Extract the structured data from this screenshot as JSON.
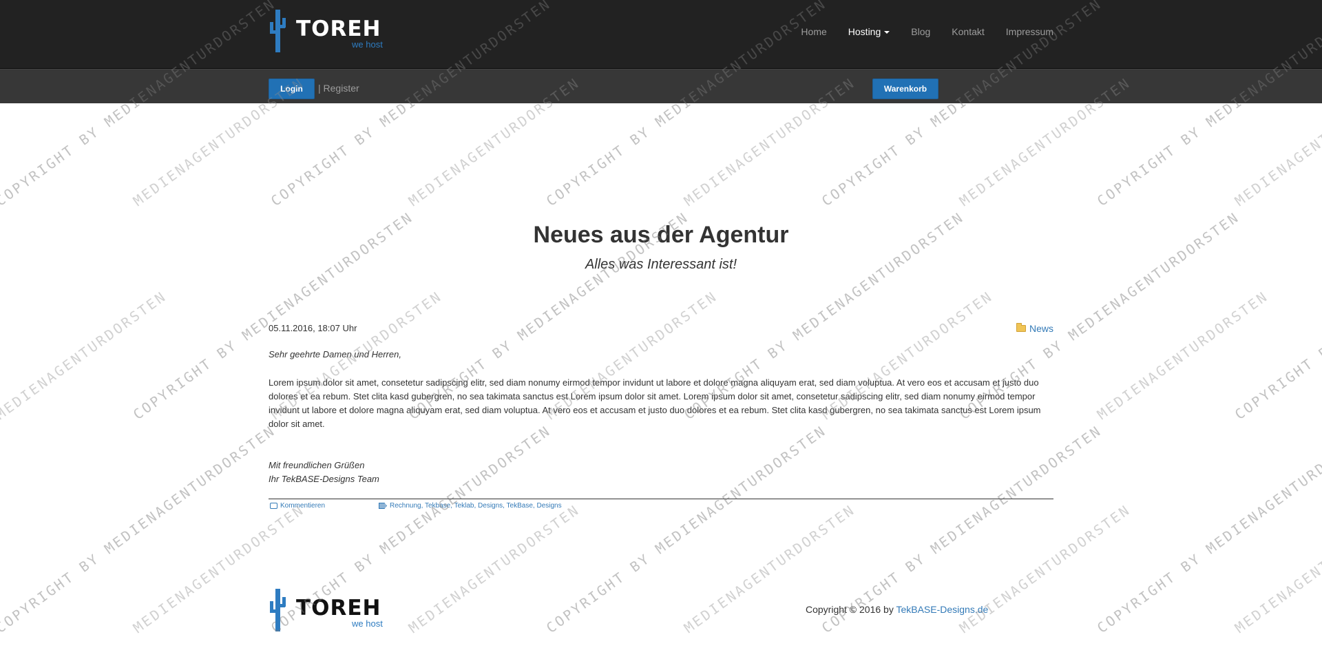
{
  "header": {
    "logo": {
      "word": "TOREH",
      "sub": "we host"
    },
    "nav": [
      {
        "label": "Home"
      },
      {
        "label": "Hosting",
        "active": true,
        "has_dropdown": true
      },
      {
        "label": "Blog"
      },
      {
        "label": "Kontakt"
      },
      {
        "label": "Impressum"
      }
    ]
  },
  "subbar": {
    "login_label": "Login",
    "register_label": "| Register",
    "cart_label": "Warenkorb"
  },
  "hero": {
    "title": "Neues aus der Agentur",
    "subtitle": "Alles was Interessant ist!"
  },
  "post": {
    "date": "05.11.2016, 18:07 Uhr",
    "category": "News",
    "salutation": "Sehr geehrte Damen und Herren,",
    "body": "Lorem ipsum dolor sit amet, consetetur sadipscing elitr, sed diam nonumy eirmod tempor invidunt ut labore et dolore magna aliquyam erat, sed diam voluptua. At vero eos et accusam et justo duo dolores et ea rebum. Stet clita kasd gubergren, no sea takimata sanctus est Lorem ipsum dolor sit amet. Lorem ipsum dolor sit amet, consetetur sadipscing elitr, sed diam nonumy eirmod tempor invidunt ut labore et dolore magna aliquyam erat, sed diam voluptua. At vero eos et accusam et justo duo dolores et ea rebum. Stet clita kasd gubergren, no sea takimata sanctus est Lorem ipsum dolor sit amet.",
    "closing_line1": "Mit freundlichen Grüßen",
    "closing_line2": "Ihr TekBASE-Designs Team",
    "comments_link": "Kommentieren",
    "tags": "Rechnung, Tekbase, Teklab, Designs, TekBase, Designs"
  },
  "footer": {
    "logo": {
      "word": "TOREH",
      "sub": "we host"
    },
    "copyright_prefix": "Copyright © 2016 by ",
    "copyright_site": "TekBASE-Designs.de"
  },
  "watermark": {
    "text_a": "COPYRIGHT BY MEDIENAGENTURDORSTEN",
    "text_b": "MEDIENAGENTURDORSTEN"
  },
  "colors": {
    "header_bg": "#222222",
    "subbar_bg": "#373737",
    "accent": "#2171b5",
    "link": "#337ab7"
  }
}
